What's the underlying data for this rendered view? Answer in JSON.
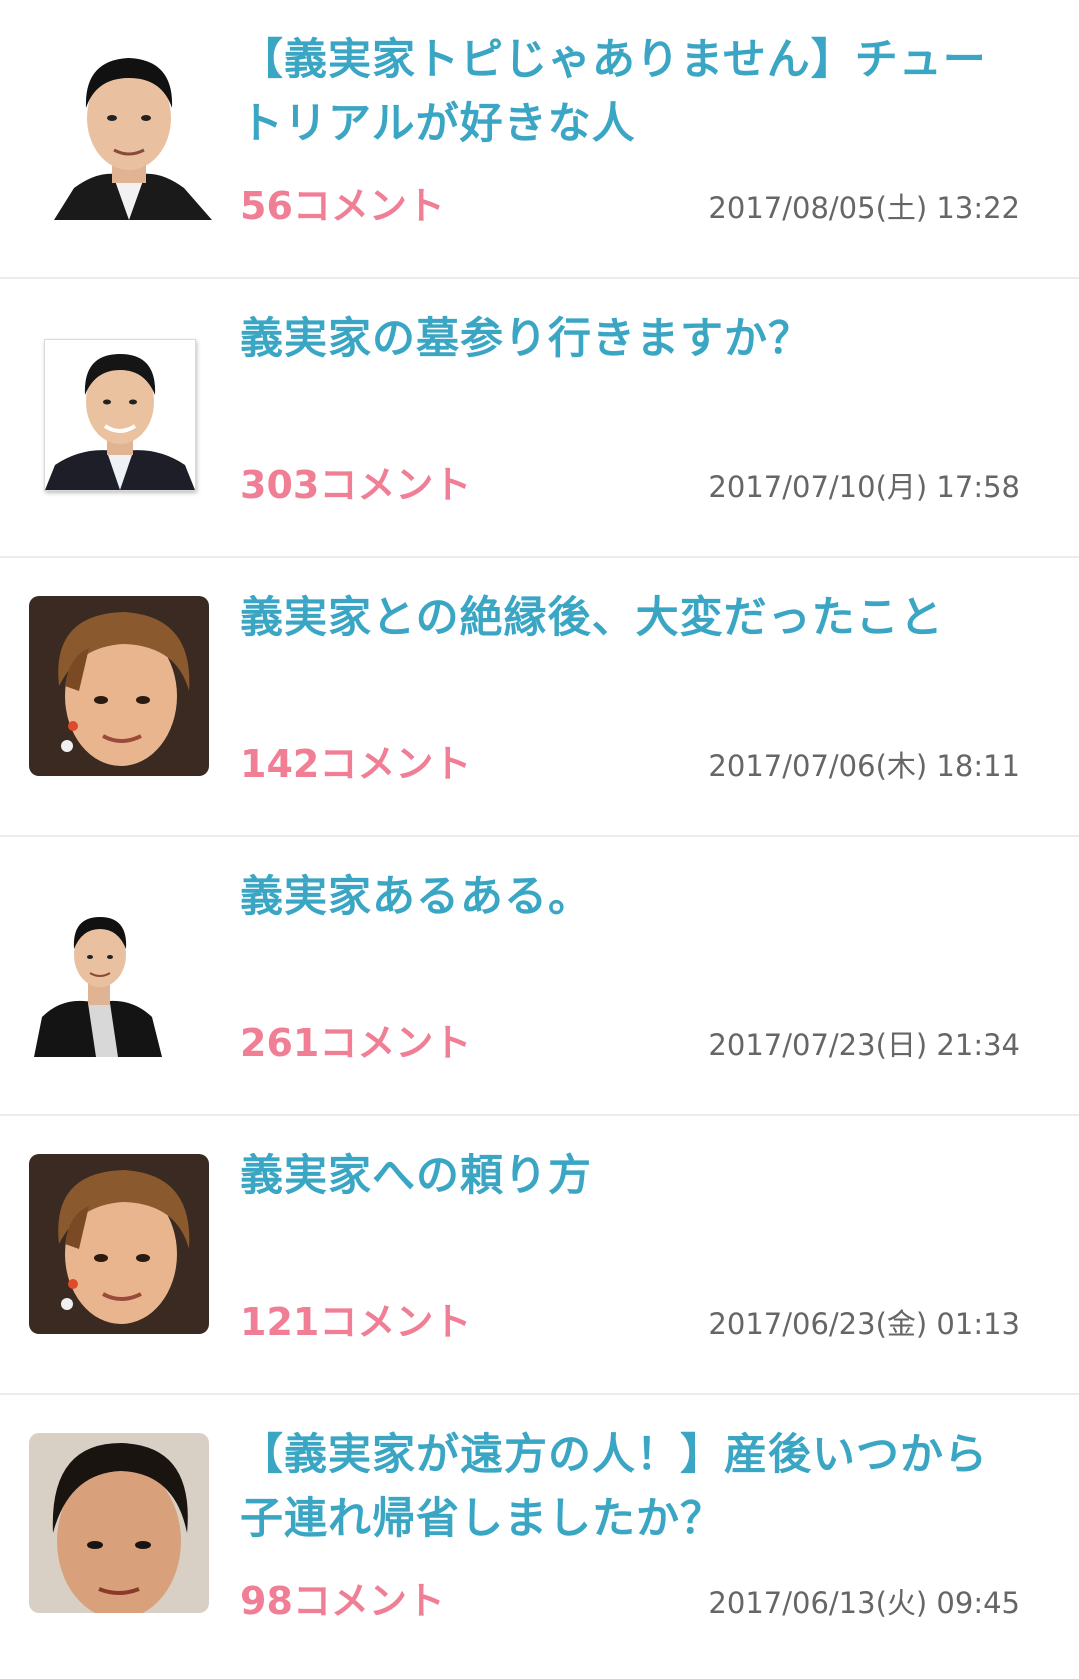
{
  "topics": [
    {
      "title": "【義実家トピじゃありません】チュートリアルが好きな人",
      "comments": "56コメント",
      "date": "2017/08/05(土) 13:22",
      "thumbnail": "portrait-suit-cutout"
    },
    {
      "title": "義実家の墓参り行きますか？",
      "comments": "303コメント",
      "date": "2017/07/10(月) 17:58",
      "thumbnail": "portrait-suit-framed"
    },
    {
      "title": "義実家との絶縁後、大変だったこと",
      "comments": "142コメント",
      "date": "2017/07/06(木) 18:11",
      "thumbnail": "portrait-brown-hair"
    },
    {
      "title": "義実家あるある。",
      "comments": "261コメント",
      "date": "2017/07/23(日) 21:34",
      "thumbnail": "portrait-jacket-cutout"
    },
    {
      "title": "義実家への頼り方",
      "comments": "121コメント",
      "date": "2017/06/23(金) 01:13",
      "thumbnail": "portrait-brown-hair"
    },
    {
      "title": "【義実家が遠方の人！】産後いつから子連れ帰省しましたか？",
      "comments": "98コメント",
      "date": "2017/06/13(火) 09:45",
      "thumbnail": "portrait-closeup"
    }
  ],
  "colors": {
    "title": "#3aa6c4",
    "comments": "#f07f96",
    "date": "#666666",
    "divider": "#ececec"
  }
}
